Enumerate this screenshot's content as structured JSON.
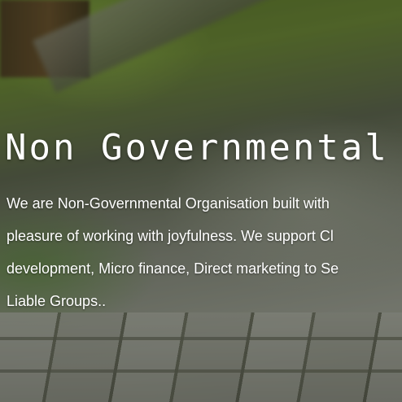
{
  "hero": {
    "title": "Non Governmental O",
    "description_lines": [
      "We are Non-Governmental Organisation built with",
      "pleasure of working with joyfulness. We support Cl",
      "development, Micro finance, Direct marketing to Se",
      "Liable Groups.."
    ]
  }
}
